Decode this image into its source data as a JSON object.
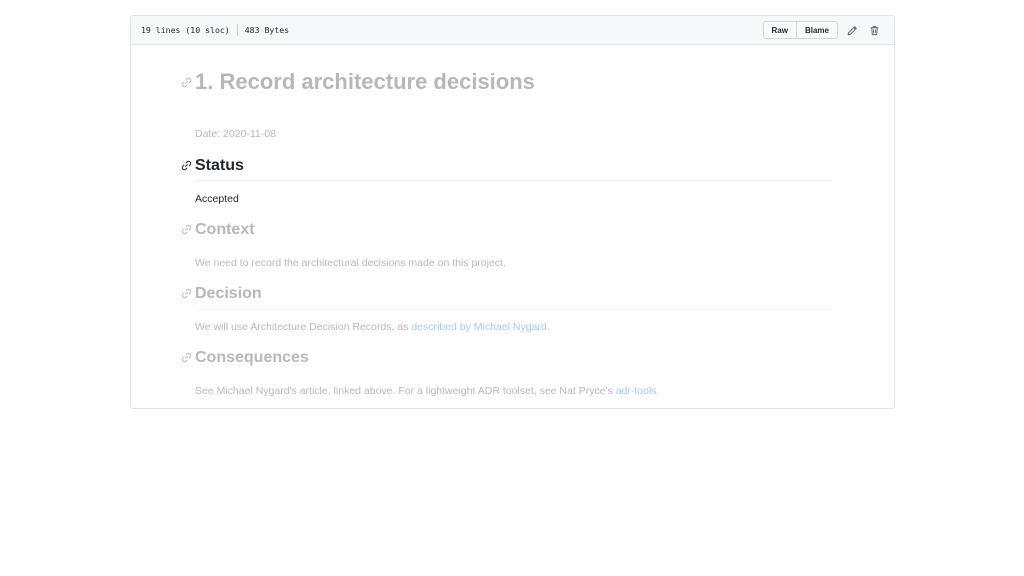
{
  "file_header": {
    "lines_info": "19 lines (10 sloc)",
    "size_info": "483 Bytes",
    "raw_label": "Raw",
    "blame_label": "Blame",
    "edit_icon": "pencil-icon",
    "delete_icon": "trash-icon"
  },
  "document": {
    "title": "1. Record architecture decisions",
    "date_line": "Date: 2020-11-08",
    "sections": [
      {
        "heading": "Status",
        "body": "Accepted"
      },
      {
        "heading": "Context",
        "body": "We need to record the architectural decisions made on this project."
      },
      {
        "heading": "Decision",
        "body_before": "We will use Architecture Decision Records, as ",
        "link_text": "described by Michael Nygard",
        "body_after": "."
      },
      {
        "heading": "Consequences",
        "body_before": "See Michael Nygard's article, linked above. For a lightweight ADR toolset, see Nat Pryce's ",
        "link_text": "adr-tools",
        "body_after": "."
      }
    ]
  },
  "colors": {
    "link": "#0366d6",
    "text": "#24292e",
    "faded_text": "#b4b8bd",
    "border": "#e1e4e8"
  }
}
